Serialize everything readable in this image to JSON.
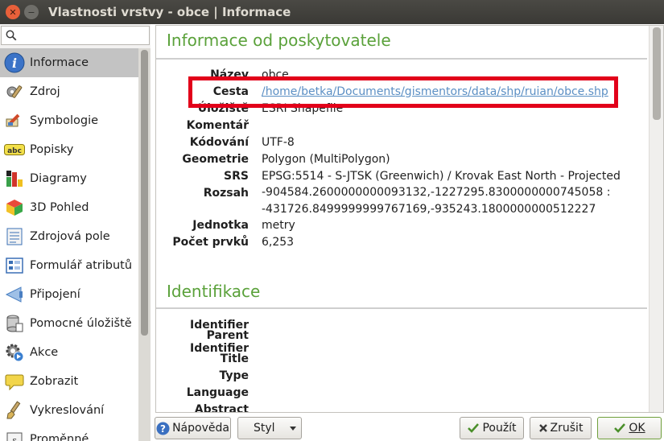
{
  "window": {
    "title": "Vlastnosti vrstvy - obce | Informace"
  },
  "search": {
    "placeholder": ""
  },
  "sidebar": {
    "items": [
      {
        "label": "Informace",
        "icon": "info-icon",
        "selected": true
      },
      {
        "label": "Zdroj",
        "icon": "source-wrench-icon"
      },
      {
        "label": "Symbologie",
        "icon": "symbology-brush-icon"
      },
      {
        "label": "Popisky",
        "icon": "labels-abc-icon"
      },
      {
        "label": "Diagramy",
        "icon": "diagram-icon"
      },
      {
        "label": "3D Pohled",
        "icon": "cube-3d-icon"
      },
      {
        "label": "Zdrojová pole",
        "icon": "fields-icon"
      },
      {
        "label": "Formulář atributů",
        "icon": "attribute-form-icon"
      },
      {
        "label": "Připojení",
        "icon": "join-icon"
      },
      {
        "label": "Pomocné úložiště",
        "icon": "auxiliary-storage-icon"
      },
      {
        "label": "Akce",
        "icon": "action-gear-icon"
      },
      {
        "label": "Zobrazit",
        "icon": "display-bubble-icon"
      },
      {
        "label": "Vykreslování",
        "icon": "rendering-brush-icon"
      },
      {
        "label": "Proměnné",
        "icon": "variables-icon"
      }
    ]
  },
  "info": {
    "title": "Informace od poskytovatele",
    "rows": [
      {
        "key": "Název",
        "value": "obce"
      },
      {
        "key": "Cesta",
        "value": "/home/betka/Documents/gismentors/data/shp/ruian/obce.shp"
      },
      {
        "key": "Úložiště",
        "value": "ESRI Shapefile"
      },
      {
        "key": "Komentář",
        "value": ""
      },
      {
        "key": "Kódování",
        "value": "UTF-8"
      },
      {
        "key": "Geometrie",
        "value": "Polygon (MultiPolygon)"
      },
      {
        "key": "SRS",
        "value": "EPSG:5514 - S-JTSK (Greenwich) / Krovak East North - Projected"
      }
    ],
    "rozsah": {
      "key": "Rozsah",
      "line1": "-904584.2600000000093132,-1227295.8300000000745058 :",
      "line2": "-431726.8499999999767169,-935243.1800000000512227"
    },
    "jednotka": {
      "key": "Jednotka",
      "value": "metry"
    },
    "pocet": {
      "key": "Počet prvků",
      "value": "6,253"
    }
  },
  "identifikace": {
    "title": "Identifikace",
    "rows": [
      "Identifier",
      "Parent Identifier",
      "Title",
      "Type",
      "Language",
      "Abstract"
    ]
  },
  "buttons": {
    "help": "Nápověda",
    "style": "Styl",
    "apply": "Použít",
    "cancel": "Zrušit",
    "ok": "OK"
  },
  "colors": {
    "accent_green": "#5aa13a",
    "highlight_red": "#e2001a",
    "link": "#5b8fc4"
  }
}
